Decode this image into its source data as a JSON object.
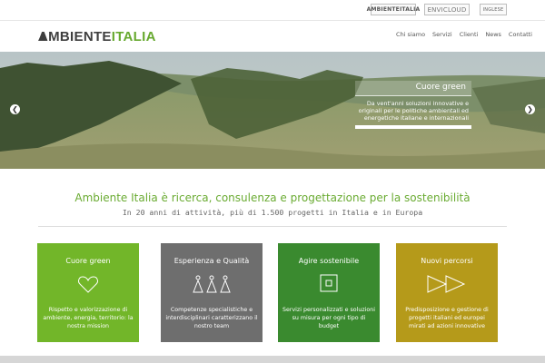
{
  "topbar": {
    "partners": [
      {
        "label": "AMBIENTEITALIA"
      },
      {
        "label": "ENVICLOUD"
      },
      {
        "label": "INGLESE"
      }
    ]
  },
  "header": {
    "logo_part1": "AMBIENTE",
    "logo_part2": "ITALIA",
    "nav": [
      "Chi siamo",
      "Servizi",
      "Clienti",
      "News",
      "Contatti"
    ]
  },
  "hero": {
    "caption_title": "Cuore green",
    "caption_text": "Da vent'anni soluzioni innovative e originali per le politiche ambientali ed energetiche italiane e internazionali",
    "prev_icon": "chevron-left-icon",
    "next_icon": "chevron-right-icon"
  },
  "tagline": "Ambiente Italia è ricerca, consulenza e progettazione per la sostenibilità",
  "subtagline": "In 20 anni di attività, più di 1.500 progetti in Italia e in Europa",
  "cards": [
    {
      "title": "Cuore green",
      "text": "Rispetto e valorizzazione di ambiente, energia, territorio: la nostra mission",
      "color": "#72b629",
      "icon": "heart-outline-icon"
    },
    {
      "title": "Esperienza e Qualità",
      "text": "Competenze specialistiche e interdisciplinari caratterizzano il nostro team",
      "color": "#6e6e6e",
      "icon": "team-people-icon"
    },
    {
      "title": "Agire sostenibile",
      "text": "Servizi personalizzati e soluzioni su misura per ogni tipo di budget",
      "color": "#3a8a2f",
      "icon": "square-target-icon"
    },
    {
      "title": "Nuovi percorsi",
      "text": "Predisposizione e gestione di progetti italiani ed europei mirati ad azioni innovative",
      "color": "#b59a1a",
      "icon": "double-arrow-icon"
    }
  ],
  "colors": {
    "brand_green": "#6aab32"
  }
}
